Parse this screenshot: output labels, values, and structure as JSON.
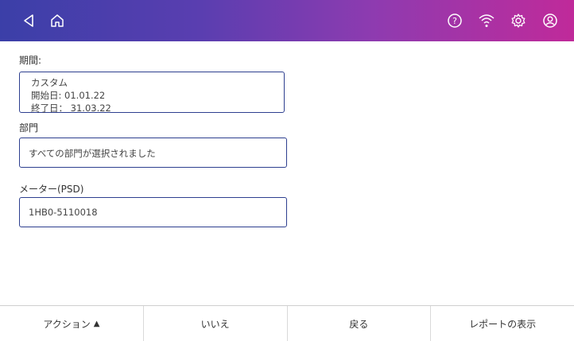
{
  "topbar": {
    "icons": [
      "back-icon",
      "home-icon",
      "help-icon",
      "wifi-icon",
      "settings-icon",
      "account-icon"
    ]
  },
  "period": {
    "label": "期間:",
    "type": "カスタム",
    "start": "開始日: 01.01.22",
    "end": "終了日： 31.03.22"
  },
  "department": {
    "label": "部門",
    "value": "すべての部門が選択されました"
  },
  "meter": {
    "label": "メーター(PSD)",
    "value": "1HB0-5110018"
  },
  "footer": {
    "action_label": "アクション",
    "action_icon": "triangle-up-icon",
    "no_label": "いいえ",
    "back_label": "戻る",
    "show_report_label": "レポートの表示"
  }
}
